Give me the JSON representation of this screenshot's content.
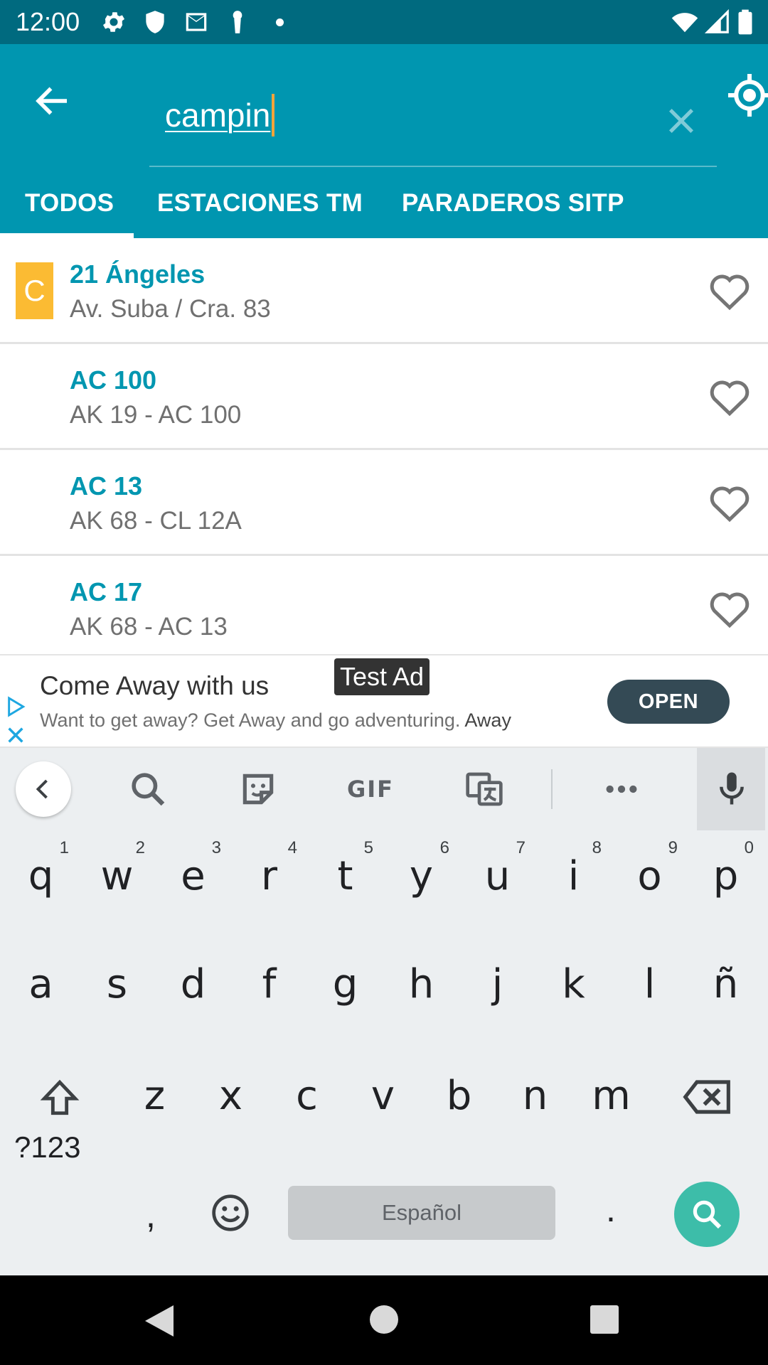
{
  "status_bar": {
    "time": "12:00",
    "icons": [
      "gear-icon",
      "shield-icon",
      "mail-icon",
      "keyhole-icon",
      "dot-icon",
      "wifi-icon",
      "signal-icon",
      "battery-icon"
    ]
  },
  "header": {
    "search_value": "campin",
    "icons": [
      "back-arrow-icon",
      "close-icon",
      "my-location-icon"
    ]
  },
  "tabs": [
    {
      "label": "TODOS",
      "selected": true
    },
    {
      "label": "ESTACIONES TM",
      "selected": false
    },
    {
      "label": "PARADEROS SITP",
      "selected": false
    }
  ],
  "results": [
    {
      "badge": "C",
      "badge_color": "#fbbb33",
      "title": "21 Ángeles",
      "subtitle": "Av. Suba / Cra. 83"
    },
    {
      "badge": "",
      "title": "AC 100",
      "subtitle": "AK 19 - AC 100"
    },
    {
      "badge": "",
      "title": "AC 13",
      "subtitle": "AK 68 - CL 12A"
    },
    {
      "badge": "",
      "title": "AC 17",
      "subtitle": "AK 68 - AC 13"
    }
  ],
  "ad": {
    "label": "Test Ad",
    "title": "Come Away with us",
    "description": "Want to get away? Get Away and go adventuring.",
    "description_strong": "Away",
    "cta": "OPEN"
  },
  "keyboard": {
    "toolbar_icons": [
      "chevron-left-icon",
      "search-icon",
      "sticker-icon",
      "gif-icon",
      "translate-icon",
      "more-icon",
      "mic-icon"
    ],
    "gif_label": "GIF",
    "row1": [
      {
        "k": "q",
        "h": "1"
      },
      {
        "k": "w",
        "h": "2"
      },
      {
        "k": "e",
        "h": "3"
      },
      {
        "k": "r",
        "h": "4"
      },
      {
        "k": "t",
        "h": "5"
      },
      {
        "k": "y",
        "h": "6"
      },
      {
        "k": "u",
        "h": "7"
      },
      {
        "k": "i",
        "h": "8"
      },
      {
        "k": "o",
        "h": "9"
      },
      {
        "k": "p",
        "h": "0"
      }
    ],
    "row2": [
      "a",
      "s",
      "d",
      "f",
      "g",
      "h",
      "j",
      "k",
      "l",
      "ñ"
    ],
    "row3": [
      "z",
      "x",
      "c",
      "v",
      "b",
      "n",
      "m"
    ],
    "symbols_label": "?123",
    "comma": ",",
    "space_label": "Español",
    "period": "."
  },
  "colors": {
    "status_bar": "#006a7f",
    "app_bar": "#0096b0",
    "accent_title": "#0096b0",
    "caret": "#f3a43a",
    "badge_yellow": "#fbbb33",
    "keyboard_bg": "#eceff1",
    "search_key": "#3dbda9",
    "ad_button": "#344a55"
  }
}
